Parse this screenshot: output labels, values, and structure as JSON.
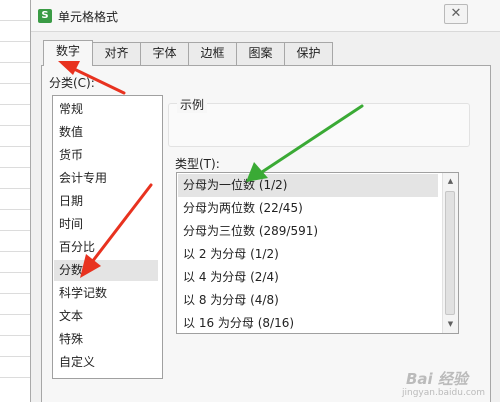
{
  "window": {
    "title": "单元格格式",
    "app_icon_letter": "S",
    "close_glyph": "✕"
  },
  "tabs": [
    {
      "label": "数字",
      "active": true
    },
    {
      "label": "对齐",
      "active": false
    },
    {
      "label": "字体",
      "active": false
    },
    {
      "label": "边框",
      "active": false
    },
    {
      "label": "图案",
      "active": false
    },
    {
      "label": "保护",
      "active": false
    }
  ],
  "category": {
    "label": "分类(C):",
    "items": [
      "常规",
      "数值",
      "货币",
      "会计专用",
      "日期",
      "时间",
      "百分比",
      "分数",
      "科学记数",
      "文本",
      "特殊",
      "自定义"
    ],
    "selected": "分数"
  },
  "sample": {
    "label": "示例",
    "value": ""
  },
  "type": {
    "label": "类型(T):",
    "items": [
      "分母为一位数 (1/2)",
      "分母为两位数 (22/45)",
      "分母为三位数 (289/591)",
      "以 2 为分母 (1/2)",
      "以 4 为分母 (2/4)",
      "以 8 为分母 (4/8)",
      "以 16 为分母 (8/16)"
    ],
    "selected": "分母为一位数 (1/2)"
  },
  "scrollbar": {
    "up_glyph": "▲",
    "down_glyph": "▼"
  },
  "watermark": {
    "line1": "Bai 经验",
    "line2": "jingyan.baidu.com"
  },
  "colors": {
    "red_arrow": "#e8321f",
    "green_arrow": "#3aaa35",
    "selection": "#e4e4e4"
  }
}
